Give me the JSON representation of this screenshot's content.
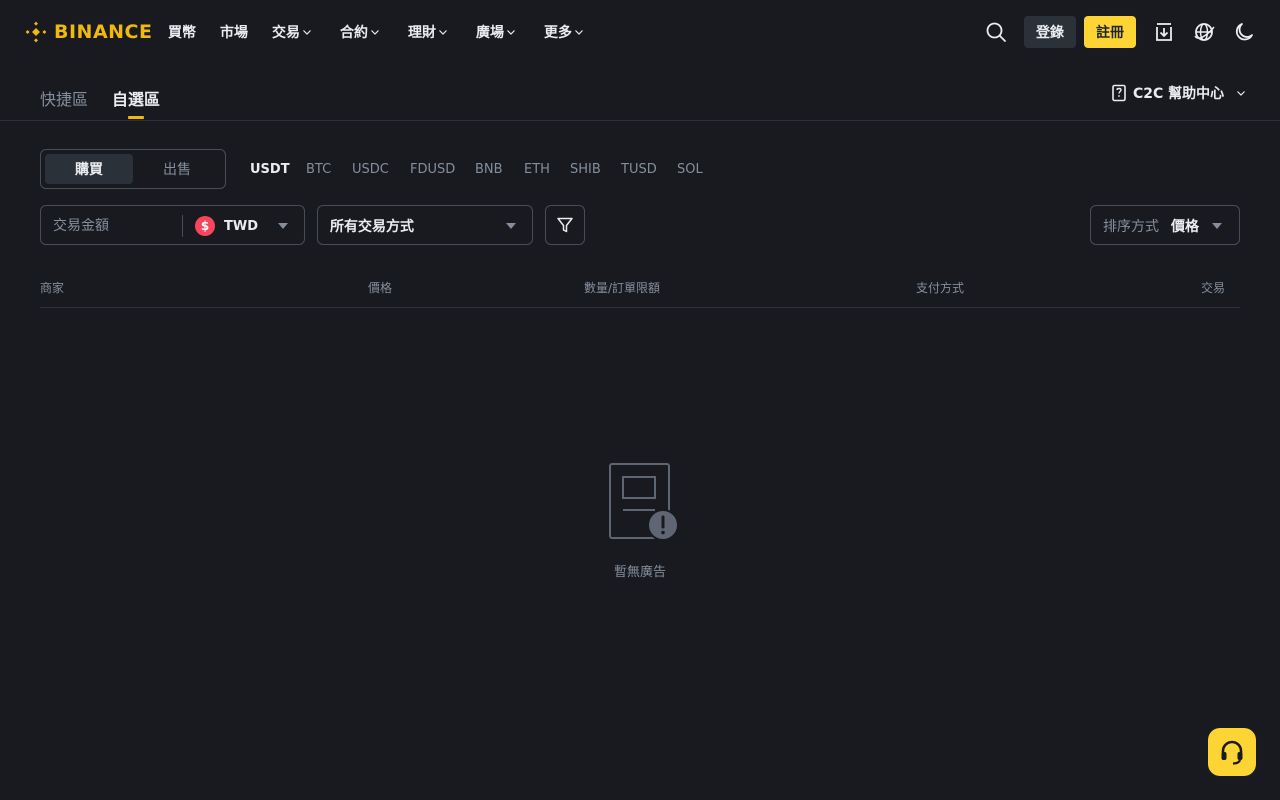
{
  "brand": {
    "name": "BINANCE",
    "color": "#f0b90b"
  },
  "nav": {
    "items": [
      {
        "label": "買幣",
        "dropdown": false
      },
      {
        "label": "市場",
        "dropdown": false
      },
      {
        "label": "交易",
        "dropdown": true
      },
      {
        "label": "合約",
        "dropdown": true
      },
      {
        "label": "理財",
        "dropdown": true
      },
      {
        "label": "廣場",
        "dropdown": true
      },
      {
        "label": "更多",
        "dropdown": true
      }
    ],
    "login_label": "登錄",
    "register_label": "註冊",
    "icons": [
      "search-icon",
      "download-icon",
      "globe-icon",
      "moon-icon"
    ]
  },
  "subtabs": {
    "items": [
      {
        "label": "快捷區",
        "active": false
      },
      {
        "label": "自選區",
        "active": true
      }
    ],
    "help_label": "C2C 幫助中心"
  },
  "trade_side": {
    "buy_label": "購買",
    "sell_label": "出售",
    "selected": "購買"
  },
  "assets": {
    "items": [
      "USDT",
      "BTC",
      "USDC",
      "FDUSD",
      "BNB",
      "ETH",
      "SHIB",
      "TUSD",
      "SOL"
    ],
    "selected": "USDT"
  },
  "filters": {
    "amount_placeholder": "交易金額",
    "currency": {
      "code": "TWD",
      "symbol": "$"
    },
    "payment_method": "所有交易方式",
    "sort_label": "排序方式",
    "sort_value": "價格"
  },
  "table": {
    "headers": [
      "商家",
      "價格",
      "數量/訂單限額",
      "支付方式",
      "交易"
    ],
    "empty_text": "暫無廣告"
  },
  "colors": {
    "background": "#181a20",
    "accent": "#fcd535",
    "brand": "#f0b90b",
    "muted_text": "#848e9c",
    "border": "#474d57"
  }
}
